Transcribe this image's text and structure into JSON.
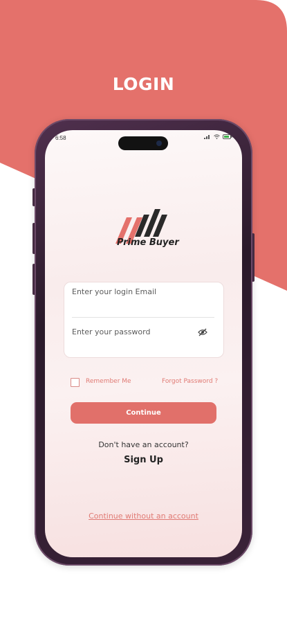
{
  "page": {
    "title": "LOGIN",
    "accent_color": "#e4716b"
  },
  "status_bar": {
    "time": "6:58",
    "icons": [
      "signal-icon",
      "wifi-icon",
      "battery-icon"
    ]
  },
  "logo": {
    "brand_name": "Prime Buyer"
  },
  "form": {
    "email_placeholder": "Enter your login Email",
    "password_placeholder": "Enter your password",
    "remember_label": "Remember Me",
    "forgot_label": "Forgot Password ?",
    "continue_label": "Continue"
  },
  "footer": {
    "no_account_text": "Don't have an account?",
    "signup_label": "Sign Up",
    "continue_without_label": "Continue without an account"
  }
}
